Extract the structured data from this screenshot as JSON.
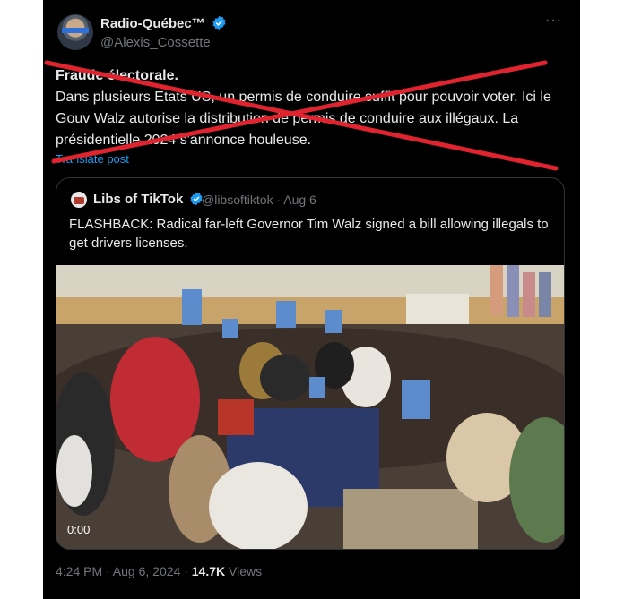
{
  "post": {
    "author_name": "Radio-Québec™",
    "author_handle": "@Alexis_Cossette",
    "more_icon": "more-horizontal-icon",
    "text_title": "Fraude électorale.",
    "text_body": "Dans plusieurs Etats US, un permis de conduire suffit pour pouvoir voter. Ici le Gouv Walz autorise la distribution de permis de conduire aux illégaux. La présidentielle 2024 s'annonce houleuse.",
    "translate_label": "Translate post",
    "timestamp": "4:24 PM · Aug 6, 2024 · ",
    "views_count": "14.7K",
    "views_label": " Views"
  },
  "quoted": {
    "author_name": "Libs of TikTok",
    "author_handle": "@libsoftiktok · Aug 6",
    "text": "FLASHBACK: Radical far-left Governor Tim Walz signed a bill allowing illegals to get drivers licenses.",
    "video_time": "0:00"
  },
  "colors": {
    "background": "#000000",
    "text": "#e7e9ea",
    "muted": "#71767b",
    "link": "#1d9bf0",
    "verified": "#1d9bf0",
    "strike": "#e0242f"
  }
}
